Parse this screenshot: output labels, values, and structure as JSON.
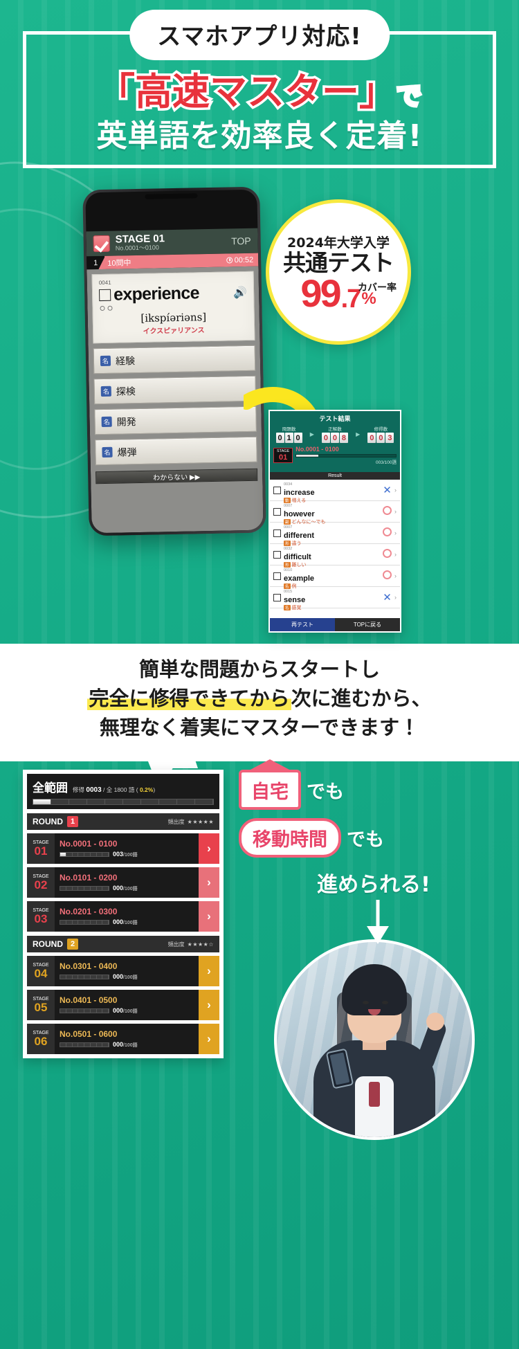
{
  "hero": {
    "pill_label": "スマホアプリ対応!",
    "line2_red": "「高速マスター」",
    "line2_white": "で",
    "line3": "英単語を効率良く定着!"
  },
  "phone": {
    "header": {
      "stage_title": "STAGE 01",
      "stage_range": "No.0001〜0100",
      "top_button": "TOP"
    },
    "progress_bar": {
      "current": "1",
      "total_label": "10問中",
      "timer": "00:52"
    },
    "card": {
      "index": "0041",
      "word": "experience",
      "ipa": "[ikspíəriəns]",
      "katakana": "イクスピァリアンス",
      "speaker_icon": "speaker-icon"
    },
    "options": [
      {
        "pos": "名",
        "label": "経験"
      },
      {
        "pos": "名",
        "label": "探検"
      },
      {
        "pos": "名",
        "label": "開発"
      },
      {
        "pos": "名",
        "label": "爆弾"
      }
    ],
    "dont_know_button": "わからない ▶▶"
  },
  "badge": {
    "line1": "2024年大学入学",
    "line2": "共通テスト",
    "coverage_label": "カバー率",
    "number": "99",
    "decimal": ".7",
    "percent": "%"
  },
  "result_panel": {
    "title": "テスト結果",
    "stats": [
      {
        "label": "問題数",
        "value": "010"
      },
      {
        "label": "正解数",
        "value": "008"
      },
      {
        "label": "修得数",
        "value": "003"
      }
    ],
    "stage_badge_top": "STAGE",
    "stage_badge_num": "01",
    "stage_range": "No.0001 - 0100",
    "stage_count": "003",
    "stage_total": "/100語",
    "result_header": "Result",
    "words": [
      {
        "no": "0034",
        "en": "increase",
        "pos": "動",
        "ja": "増える",
        "mark": "x"
      },
      {
        "no": "0007",
        "en": "however",
        "pos": "副",
        "ja": "どんなに〜でも",
        "mark": "o"
      },
      {
        "no": "0007",
        "en": "different",
        "pos": "形",
        "ja": "違う",
        "mark": "o"
      },
      {
        "no": "0032",
        "en": "difficult",
        "pos": "形",
        "ja": "難しい",
        "mark": "o"
      },
      {
        "no": "0010",
        "en": "example",
        "pos": "名",
        "ja": "例",
        "mark": "o"
      },
      {
        "no": "0015",
        "en": "sense",
        "pos": "名",
        "ja": "感覚",
        "mark": "x"
      }
    ],
    "buttons": {
      "retry": "再テスト",
      "back": "TOPに戻る"
    }
  },
  "mid_message": {
    "line1": "簡単な問題からスタートし",
    "line2_a": "完全に修得できてから",
    "line2_b": "次に進むから、",
    "line3": "無理なく着実にマスターできます！"
  },
  "stage_list": {
    "header": {
      "title": "全範囲",
      "label_shutoku": "修得",
      "value_shutoku": "0003",
      "sep": "/ 全 1800 語 (",
      "percent": "0.2%",
      "close": ")"
    },
    "rounds": [
      {
        "name": "ROUND",
        "num": "1",
        "freq_label": "頻出度",
        "stars": "★★★★★",
        "color": "#e8414c",
        "stages": [
          {
            "stage_label": "STAGE",
            "stage_num": "01",
            "range": "No.0001 - 0100",
            "count": "003",
            "total": "/100語",
            "filled": true
          },
          {
            "stage_label": "STAGE",
            "stage_num": "02",
            "range": "No.0101 - 0200",
            "count": "000",
            "total": "/100語",
            "filled": false
          },
          {
            "stage_label": "STAGE",
            "stage_num": "03",
            "range": "No.0201 - 0300",
            "count": "000",
            "total": "/100語",
            "filled": false
          }
        ]
      },
      {
        "name": "ROUND",
        "num": "2",
        "freq_label": "頻出度",
        "stars": "★★★★☆",
        "color": "#e0a321",
        "stages": [
          {
            "stage_label": "STAGE",
            "stage_num": "04",
            "range": "No.0301 - 0400",
            "count": "000",
            "total": "/100語",
            "filled": false
          },
          {
            "stage_label": "STAGE",
            "stage_num": "05",
            "range": "No.0401 - 0500",
            "count": "000",
            "total": "/100語",
            "filled": false
          },
          {
            "stage_label": "STAGE",
            "stage_num": "06",
            "range": "No.0501 - 0600",
            "count": "000",
            "total": "/100語",
            "filled": false
          }
        ]
      }
    ]
  },
  "promo": {
    "home_label": "自宅",
    "demo1": "でも",
    "commute_label": "移動時間",
    "demo2": "でも",
    "line3": "進められる!"
  },
  "colors": {
    "bg_green": "#14a985",
    "accent_red": "#e8323c",
    "accent_yellow": "#f7e93f",
    "pink": "#f0607a",
    "round1": "#e8414c",
    "round2": "#e0a321"
  }
}
